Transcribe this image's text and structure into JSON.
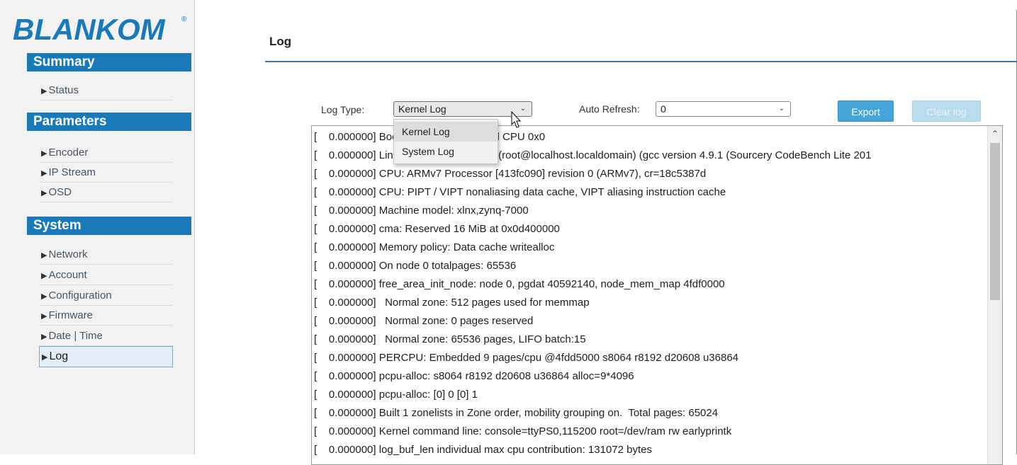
{
  "brand": {
    "logo_text": "BLANKOM",
    "registered": "®"
  },
  "sidebar": {
    "sections": [
      {
        "title": "Summary",
        "items": [
          {
            "label": "Status"
          }
        ]
      },
      {
        "title": "Parameters",
        "items": [
          {
            "label": "Encoder"
          },
          {
            "label": "IP Stream"
          },
          {
            "label": "OSD"
          }
        ]
      },
      {
        "title": "System",
        "items": [
          {
            "label": "Network"
          },
          {
            "label": "Account"
          },
          {
            "label": "Configuration"
          },
          {
            "label": "Firmware"
          },
          {
            "label": "Date | Time"
          },
          {
            "label": "Log"
          }
        ]
      }
    ],
    "active_item": "Log"
  },
  "page": {
    "title": "Log"
  },
  "controls": {
    "log_type_label": "Log Type:",
    "log_type_value": "Kernel Log",
    "log_type_options": [
      "Kernel Log",
      "System Log"
    ],
    "auto_refresh_label": "Auto Refresh:",
    "auto_refresh_value": "0",
    "export_label": "Export",
    "clear_label": "Clear log"
  },
  "log": {
    "lines": [
      "[    0.000000] Booting Linux on physical CPU 0x0",
      "[    0.000000] Linux version 4.9.0-xilinx (root@localhost.localdomain) (gcc version 4.9.1 (Sourcery CodeBench Lite 201",
      "[    0.000000] CPU: ARMv7 Processor [413fc090] revision 0 (ARMv7), cr=18c5387d",
      "[    0.000000] CPU: PIPT / VIPT nonaliasing data cache, VIPT aliasing instruction cache",
      "[    0.000000] Machine model: xlnx,zynq-7000",
      "[    0.000000] cma: Reserved 16 MiB at 0x0d400000",
      "[    0.000000] Memory policy: Data cache writealloc",
      "[    0.000000] On node 0 totalpages: 65536",
      "[    0.000000] free_area_init_node: node 0, pgdat 40592140, node_mem_map 4fdf0000",
      "[    0.000000]   Normal zone: 512 pages used for memmap",
      "[    0.000000]   Normal zone: 0 pages reserved",
      "[    0.000000]   Normal zone: 65536 pages, LIFO batch:15",
      "[    0.000000] PERCPU: Embedded 9 pages/cpu @4fdd5000 s8064 r8192 d20608 u36864",
      "[    0.000000] pcpu-alloc: s8064 r8192 d20608 u36864 alloc=9*4096",
      "[    0.000000] pcpu-alloc: [0] 0 [0] 1",
      "[    0.000000] Built 1 zonelists in Zone order, mobility grouping on.  Total pages: 65024",
      "[    0.000000] Kernel command line: console=ttyPS0,115200 root=/dev/ram rw earlyprintk",
      "[    0.000000] log_buf_len individual max cpu contribution: 131072 bytes"
    ]
  },
  "colors": {
    "accent": "#1a79b9",
    "button": "#45a5d8",
    "rule": "#2b7fc0"
  }
}
